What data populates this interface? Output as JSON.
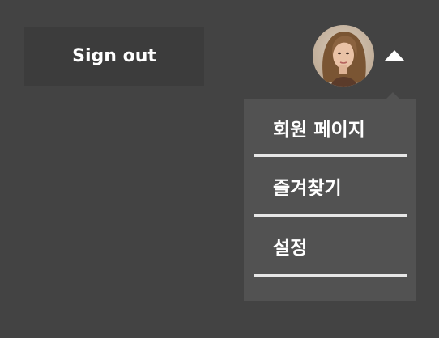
{
  "header": {
    "signout_label": "Sign out",
    "avatar_icon": "user-avatar-photo",
    "caret_icon": "caret-up-icon"
  },
  "dropdown": {
    "items": [
      {
        "label": "회원 페이지"
      },
      {
        "label": "즐겨찾기"
      },
      {
        "label": "설정"
      }
    ]
  },
  "colors": {
    "background": "#434343",
    "signout_bg": "#3c3c3c",
    "menu_bg": "#525252",
    "divider": "#e6e6e6",
    "text": "#ffffff"
  }
}
